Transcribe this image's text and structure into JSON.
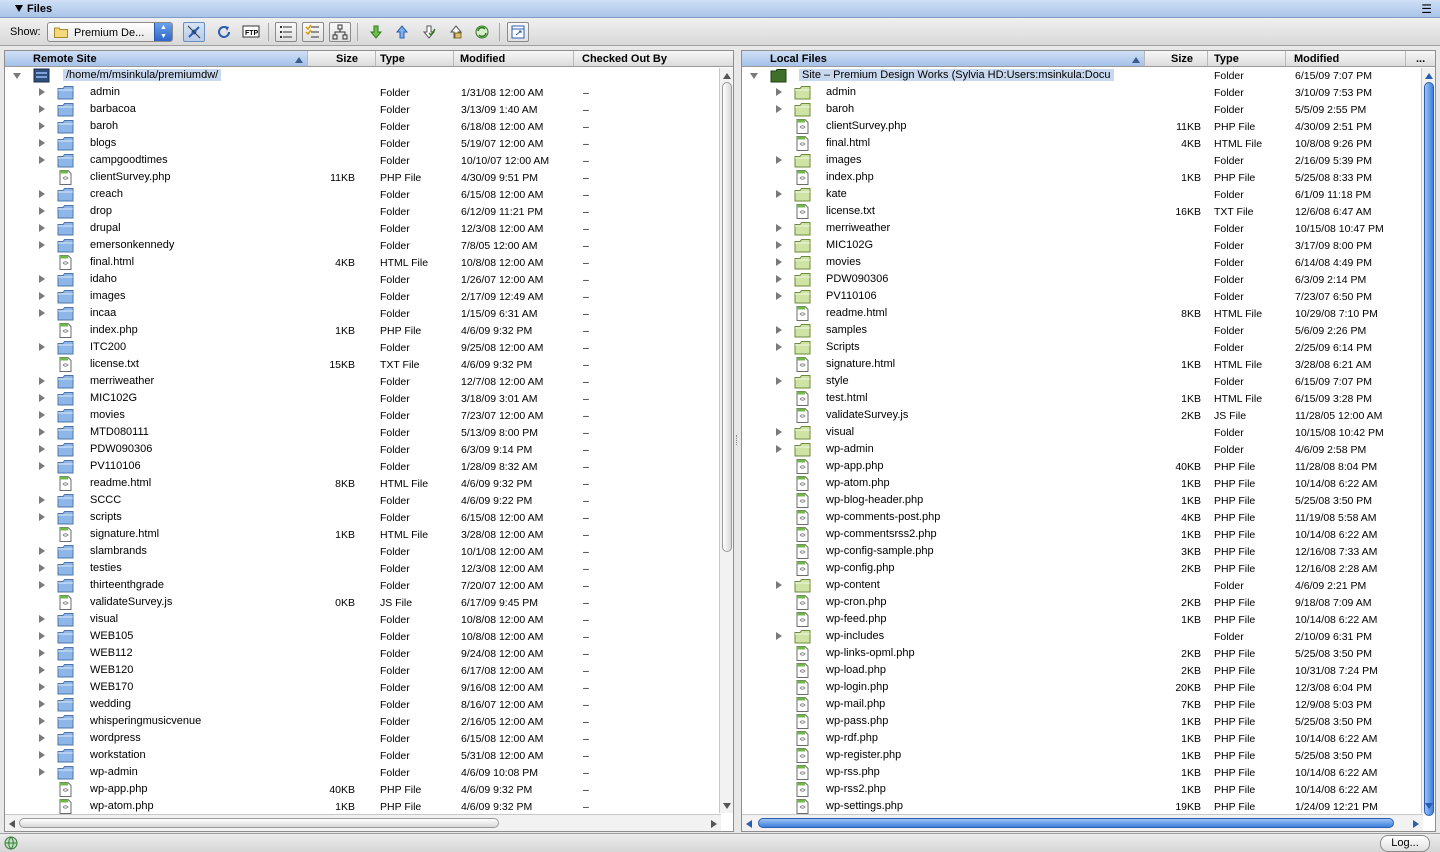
{
  "window": {
    "title": "Files"
  },
  "toolbar": {
    "show_label": "Show:",
    "site_select": {
      "value": "Premium De..."
    },
    "buttons": [
      {
        "name": "connect-button",
        "icon": "plug-icon"
      },
      {
        "name": "refresh-button",
        "icon": "refresh-icon"
      },
      {
        "name": "ftp-log-button",
        "icon": "ftp-icon",
        "text": "FTP"
      },
      {
        "name": "site-files-view-button",
        "icon": "list-view-icon"
      },
      {
        "name": "testing-server-view-button",
        "icon": "checklist-icon"
      },
      {
        "name": "repository-view-button",
        "icon": "tree-view-icon"
      },
      {
        "name": "get-files-button",
        "icon": "arrow-down-icon"
      },
      {
        "name": "put-files-button",
        "icon": "arrow-up-icon"
      },
      {
        "name": "check-out-button",
        "icon": "check-out-icon"
      },
      {
        "name": "check-in-button",
        "icon": "check-in-icon"
      },
      {
        "name": "synchronize-button",
        "icon": "sync-icon"
      },
      {
        "name": "expand-button",
        "icon": "expand-window-icon"
      }
    ]
  },
  "colors": {
    "accent": "#3f7fdc",
    "folder": "#8fb6e8",
    "local_folder": "#cfe3a5",
    "selection": "#c8d8ef"
  },
  "remote": {
    "columns": {
      "name": "Remote Site",
      "size": "Size",
      "type": "Type",
      "modified": "Modified",
      "checked_out_by": "Checked Out By"
    },
    "root": "/home/m/msinkula/premiumdw/",
    "items": [
      {
        "name": "admin",
        "size": "",
        "type": "Folder",
        "modified": "1/31/08 12:00 AM",
        "checked": "–",
        "folder": true
      },
      {
        "name": "barbacoa",
        "size": "",
        "type": "Folder",
        "modified": "3/13/09 1:40 AM",
        "checked": "–",
        "folder": true
      },
      {
        "name": "baroh",
        "size": "",
        "type": "Folder",
        "modified": "6/18/08 12:00 AM",
        "checked": "–",
        "folder": true
      },
      {
        "name": "blogs",
        "size": "",
        "type": "Folder",
        "modified": "5/19/07 12:00 AM",
        "checked": "–",
        "folder": true
      },
      {
        "name": "campgoodtimes",
        "size": "",
        "type": "Folder",
        "modified": "10/10/07 12:00 AM",
        "checked": "–",
        "folder": true
      },
      {
        "name": "clientSurvey.php",
        "size": "11KB",
        "type": "PHP File",
        "modified": "4/30/09 9:51 PM",
        "checked": "–",
        "folder": false
      },
      {
        "name": "creach",
        "size": "",
        "type": "Folder",
        "modified": "6/15/08 12:00 AM",
        "checked": "–",
        "folder": true
      },
      {
        "name": "drop",
        "size": "",
        "type": "Folder",
        "modified": "6/12/09 11:21 PM",
        "checked": "–",
        "folder": true
      },
      {
        "name": "drupal",
        "size": "",
        "type": "Folder",
        "modified": "12/3/08 12:00 AM",
        "checked": "–",
        "folder": true
      },
      {
        "name": "emersonkennedy",
        "size": "",
        "type": "Folder",
        "modified": "7/8/05 12:00 AM",
        "checked": "–",
        "folder": true
      },
      {
        "name": "final.html",
        "size": "4KB",
        "type": "HTML File",
        "modified": "10/8/08 12:00 AM",
        "checked": "–",
        "folder": false
      },
      {
        "name": "idaho",
        "size": "",
        "type": "Folder",
        "modified": "1/26/07 12:00 AM",
        "checked": "–",
        "folder": true
      },
      {
        "name": "images",
        "size": "",
        "type": "Folder",
        "modified": "2/17/09 12:49 AM",
        "checked": "–",
        "folder": true
      },
      {
        "name": "incaa",
        "size": "",
        "type": "Folder",
        "modified": "1/15/09 6:31 AM",
        "checked": "–",
        "folder": true
      },
      {
        "name": "index.php",
        "size": "1KB",
        "type": "PHP File",
        "modified": "4/6/09 9:32 PM",
        "checked": "–",
        "folder": false
      },
      {
        "name": "ITC200",
        "size": "",
        "type": "Folder",
        "modified": "9/25/08 12:00 AM",
        "checked": "–",
        "folder": true
      },
      {
        "name": "license.txt",
        "size": "15KB",
        "type": "TXT File",
        "modified": "4/6/09 9:32 PM",
        "checked": "–",
        "folder": false
      },
      {
        "name": "merriweather",
        "size": "",
        "type": "Folder",
        "modified": "12/7/08 12:00 AM",
        "checked": "–",
        "folder": true
      },
      {
        "name": "MIC102G",
        "size": "",
        "type": "Folder",
        "modified": "3/18/09 3:01 AM",
        "checked": "–",
        "folder": true
      },
      {
        "name": "movies",
        "size": "",
        "type": "Folder",
        "modified": "7/23/07 12:00 AM",
        "checked": "–",
        "folder": true
      },
      {
        "name": "MTD080111",
        "size": "",
        "type": "Folder",
        "modified": "5/13/09 8:00 PM",
        "checked": "–",
        "folder": true
      },
      {
        "name": "PDW090306",
        "size": "",
        "type": "Folder",
        "modified": "6/3/09 9:14 PM",
        "checked": "–",
        "folder": true
      },
      {
        "name": "PV110106",
        "size": "",
        "type": "Folder",
        "modified": "1/28/09 8:32 AM",
        "checked": "–",
        "folder": true
      },
      {
        "name": "readme.html",
        "size": "8KB",
        "type": "HTML File",
        "modified": "4/6/09 9:32 PM",
        "checked": "–",
        "folder": false
      },
      {
        "name": "SCCC",
        "size": "",
        "type": "Folder",
        "modified": "4/6/09 9:22 PM",
        "checked": "–",
        "folder": true
      },
      {
        "name": "scripts",
        "size": "",
        "type": "Folder",
        "modified": "6/15/08 12:00 AM",
        "checked": "–",
        "folder": true
      },
      {
        "name": "signature.html",
        "size": "1KB",
        "type": "HTML File",
        "modified": "3/28/08 12:00 AM",
        "checked": "–",
        "folder": false
      },
      {
        "name": "slambrands",
        "size": "",
        "type": "Folder",
        "modified": "10/1/08 12:00 AM",
        "checked": "–",
        "folder": true
      },
      {
        "name": "testies",
        "size": "",
        "type": "Folder",
        "modified": "12/3/08 12:00 AM",
        "checked": "–",
        "folder": true
      },
      {
        "name": "thirteenthgrade",
        "size": "",
        "type": "Folder",
        "modified": "7/20/07 12:00 AM",
        "checked": "–",
        "folder": true
      },
      {
        "name": "validateSurvey.js",
        "size": "0KB",
        "type": "JS File",
        "modified": "6/17/09 9:45 PM",
        "checked": "–",
        "folder": false
      },
      {
        "name": "visual",
        "size": "",
        "type": "Folder",
        "modified": "10/8/08 12:00 AM",
        "checked": "–",
        "folder": true
      },
      {
        "name": "WEB105",
        "size": "",
        "type": "Folder",
        "modified": "10/8/08 12:00 AM",
        "checked": "–",
        "folder": true
      },
      {
        "name": "WEB112",
        "size": "",
        "type": "Folder",
        "modified": "9/24/08 12:00 AM",
        "checked": "–",
        "folder": true
      },
      {
        "name": "WEB120",
        "size": "",
        "type": "Folder",
        "modified": "6/17/08 12:00 AM",
        "checked": "–",
        "folder": true
      },
      {
        "name": "WEB170",
        "size": "",
        "type": "Folder",
        "modified": "9/16/08 12:00 AM",
        "checked": "–",
        "folder": true
      },
      {
        "name": "wedding",
        "size": "",
        "type": "Folder",
        "modified": "8/16/07 12:00 AM",
        "checked": "–",
        "folder": true
      },
      {
        "name": "whisperingmusicvenue",
        "size": "",
        "type": "Folder",
        "modified": "2/16/05 12:00 AM",
        "checked": "–",
        "folder": true
      },
      {
        "name": "wordpress",
        "size": "",
        "type": "Folder",
        "modified": "6/15/08 12:00 AM",
        "checked": "–",
        "folder": true
      },
      {
        "name": "workstation",
        "size": "",
        "type": "Folder",
        "modified": "5/31/08 12:00 AM",
        "checked": "–",
        "folder": true
      },
      {
        "name": "wp-admin",
        "size": "",
        "type": "Folder",
        "modified": "4/6/09 10:08 PM",
        "checked": "–",
        "folder": true
      },
      {
        "name": "wp-app.php",
        "size": "40KB",
        "type": "PHP File",
        "modified": "4/6/09 9:32 PM",
        "checked": "–",
        "folder": false
      },
      {
        "name": "wp-atom.php",
        "size": "1KB",
        "type": "PHP File",
        "modified": "4/6/09 9:32 PM",
        "checked": "–",
        "folder": false
      }
    ]
  },
  "local": {
    "columns": {
      "name": "Local Files",
      "size": "Size",
      "type": "Type",
      "modified": "Modified",
      "more": "..."
    },
    "root": {
      "name": "Site – Premium Design Works (Sylvia HD:Users:msinkula:Docu",
      "type": "Folder",
      "modified": "6/15/09 7:07 PM"
    },
    "items": [
      {
        "name": "admin",
        "size": "",
        "type": "Folder",
        "modified": "3/10/09 7:53 PM",
        "folder": true
      },
      {
        "name": "baroh",
        "size": "",
        "type": "Folder",
        "modified": "5/5/09 2:55 PM",
        "folder": true
      },
      {
        "name": "clientSurvey.php",
        "size": "11KB",
        "type": "PHP File",
        "modified": "4/30/09 2:51 PM",
        "folder": false
      },
      {
        "name": "final.html",
        "size": "4KB",
        "type": "HTML File",
        "modified": "10/8/08 9:26 PM",
        "folder": false
      },
      {
        "name": "images",
        "size": "",
        "type": "Folder",
        "modified": "2/16/09 5:39 PM",
        "folder": true
      },
      {
        "name": "index.php",
        "size": "1KB",
        "type": "PHP File",
        "modified": "5/25/08 8:33 PM",
        "folder": false
      },
      {
        "name": "kate",
        "size": "",
        "type": "Folder",
        "modified": "6/1/09 11:18 PM",
        "folder": true
      },
      {
        "name": "license.txt",
        "size": "16KB",
        "type": "TXT File",
        "modified": "12/6/08 6:47 AM",
        "folder": false
      },
      {
        "name": "merriweather",
        "size": "",
        "type": "Folder",
        "modified": "10/15/08 10:47 PM",
        "folder": true
      },
      {
        "name": "MIC102G",
        "size": "",
        "type": "Folder",
        "modified": "3/17/09 8:00 PM",
        "folder": true
      },
      {
        "name": "movies",
        "size": "",
        "type": "Folder",
        "modified": "6/14/08 4:49 PM",
        "folder": true
      },
      {
        "name": "PDW090306",
        "size": "",
        "type": "Folder",
        "modified": "6/3/09 2:14 PM",
        "folder": true
      },
      {
        "name": "PV110106",
        "size": "",
        "type": "Folder",
        "modified": "7/23/07 6:50 PM",
        "folder": true
      },
      {
        "name": "readme.html",
        "size": "8KB",
        "type": "HTML File",
        "modified": "10/29/08 7:10 PM",
        "folder": false
      },
      {
        "name": "samples",
        "size": "",
        "type": "Folder",
        "modified": "5/6/09 2:26 PM",
        "folder": true
      },
      {
        "name": "Scripts",
        "size": "",
        "type": "Folder",
        "modified": "2/25/09 6:14 PM",
        "folder": true
      },
      {
        "name": "signature.html",
        "size": "1KB",
        "type": "HTML File",
        "modified": "3/28/08 6:21 AM",
        "folder": false
      },
      {
        "name": "style",
        "size": "",
        "type": "Folder",
        "modified": "6/15/09 7:07 PM",
        "folder": true
      },
      {
        "name": "test.html",
        "size": "1KB",
        "type": "HTML File",
        "modified": "6/15/09 3:28 PM",
        "folder": false
      },
      {
        "name": "validateSurvey.js",
        "size": "2KB",
        "type": "JS File",
        "modified": "11/28/05 12:00 AM",
        "folder": false
      },
      {
        "name": "visual",
        "size": "",
        "type": "Folder",
        "modified": "10/15/08 10:42 PM",
        "folder": true
      },
      {
        "name": "wp-admin",
        "size": "",
        "type": "Folder",
        "modified": "4/6/09 2:58 PM",
        "folder": true
      },
      {
        "name": "wp-app.php",
        "size": "40KB",
        "type": "PHP File",
        "modified": "11/28/08 8:04 PM",
        "folder": false
      },
      {
        "name": "wp-atom.php",
        "size": "1KB",
        "type": "PHP File",
        "modified": "10/14/08 6:22 AM",
        "folder": false
      },
      {
        "name": "wp-blog-header.php",
        "size": "1KB",
        "type": "PHP File",
        "modified": "5/25/08 3:50 PM",
        "folder": false
      },
      {
        "name": "wp-comments-post.php",
        "size": "4KB",
        "type": "PHP File",
        "modified": "11/19/08 5:58 AM",
        "folder": false
      },
      {
        "name": "wp-commentsrss2.php",
        "size": "1KB",
        "type": "PHP File",
        "modified": "10/14/08 6:22 AM",
        "folder": false
      },
      {
        "name": "wp-config-sample.php",
        "size": "3KB",
        "type": "PHP File",
        "modified": "12/16/08 7:33 AM",
        "folder": false
      },
      {
        "name": "wp-config.php",
        "size": "2KB",
        "type": "PHP File",
        "modified": "12/16/08 2:28 AM",
        "folder": false
      },
      {
        "name": "wp-content",
        "size": "",
        "type": "Folder",
        "modified": "4/6/09 2:21 PM",
        "folder": true
      },
      {
        "name": "wp-cron.php",
        "size": "2KB",
        "type": "PHP File",
        "modified": "9/18/08 7:09 AM",
        "folder": false
      },
      {
        "name": "wp-feed.php",
        "size": "1KB",
        "type": "PHP File",
        "modified": "10/14/08 6:22 AM",
        "folder": false
      },
      {
        "name": "wp-includes",
        "size": "",
        "type": "Folder",
        "modified": "2/10/09 6:31 PM",
        "folder": true
      },
      {
        "name": "wp-links-opml.php",
        "size": "2KB",
        "type": "PHP File",
        "modified": "5/25/08 3:50 PM",
        "folder": false
      },
      {
        "name": "wp-load.php",
        "size": "2KB",
        "type": "PHP File",
        "modified": "10/31/08 7:24 PM",
        "folder": false
      },
      {
        "name": "wp-login.php",
        "size": "20KB",
        "type": "PHP File",
        "modified": "12/3/08 6:04 PM",
        "folder": false
      },
      {
        "name": "wp-mail.php",
        "size": "7KB",
        "type": "PHP File",
        "modified": "12/9/08 5:03 PM",
        "folder": false
      },
      {
        "name": "wp-pass.php",
        "size": "1KB",
        "type": "PHP File",
        "modified": "5/25/08 3:50 PM",
        "folder": false
      },
      {
        "name": "wp-rdf.php",
        "size": "1KB",
        "type": "PHP File",
        "modified": "10/14/08 6:22 AM",
        "folder": false
      },
      {
        "name": "wp-register.php",
        "size": "1KB",
        "type": "PHP File",
        "modified": "5/25/08 3:50 PM",
        "folder": false
      },
      {
        "name": "wp-rss.php",
        "size": "1KB",
        "type": "PHP File",
        "modified": "10/14/08 6:22 AM",
        "folder": false
      },
      {
        "name": "wp-rss2.php",
        "size": "1KB",
        "type": "PHP File",
        "modified": "10/14/08 6:22 AM",
        "folder": false
      },
      {
        "name": "wp-settings.php",
        "size": "19KB",
        "type": "PHP File",
        "modified": "1/24/09 12:21 PM",
        "folder": false
      }
    ]
  },
  "statusbar": {
    "log_label": "Log..."
  }
}
